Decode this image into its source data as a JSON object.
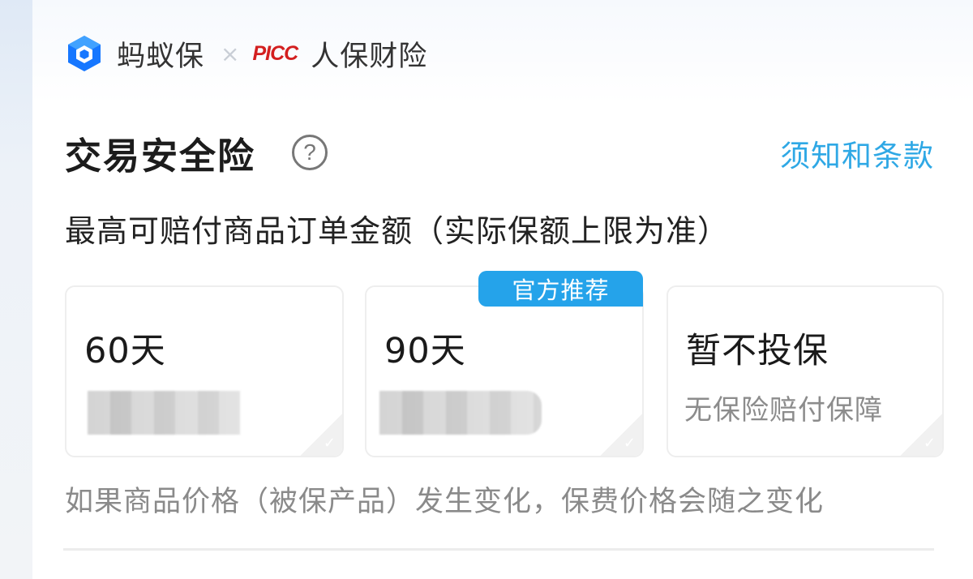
{
  "brand": {
    "partner_name": "蚂蚁保",
    "separator": "×",
    "insurer_logo_text": "PICC",
    "insurer_name": "人保财险",
    "accent_color": "#2fa8e5",
    "insurer_color": "#d31f1f"
  },
  "header": {
    "title": "交易安全险",
    "help_icon": "question-circle-icon",
    "help_glyph": "?",
    "terms_link": "须知和条款"
  },
  "subtitle": "最高可赔付商品订单金额（实际保额上限为准）",
  "options": [
    {
      "label": "60天",
      "price": ""
    },
    {
      "label": "90天",
      "badge": "官方推荐",
      "price": ""
    },
    {
      "label": "暂不投保",
      "description": "无保险赔付保障"
    }
  ],
  "note": "如果商品价格（被保产品）发生变化，保费价格会随之变化"
}
